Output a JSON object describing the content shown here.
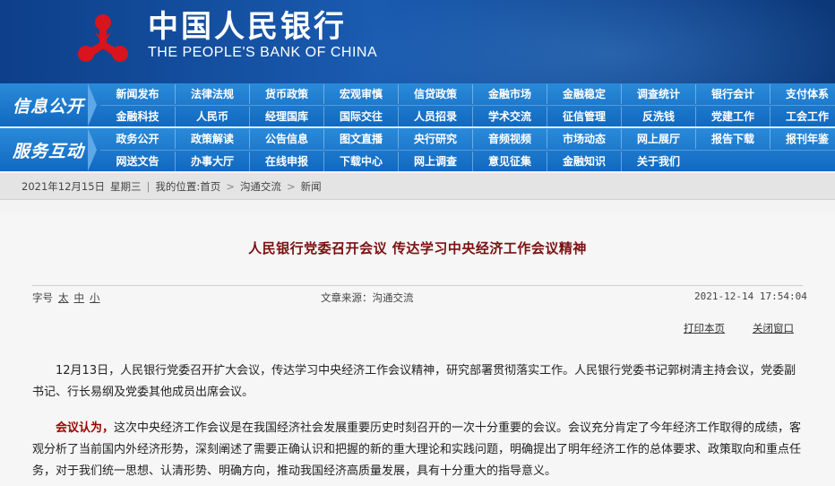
{
  "header": {
    "bank_name_cn": "中国人民银行",
    "bank_name_en": "THE PEOPLE'S BANK OF CHINA",
    "logo_icon": "pboc-emblem-icon",
    "logo_color": "#d8141c"
  },
  "nav": {
    "info_title": "信息公开",
    "service_title": "服务互动",
    "info_rows": [
      [
        "新闻发布",
        "法律法规",
        "货币政策",
        "宏观审慎",
        "信贷政策",
        "金融市场",
        "金融稳定",
        "调查统计",
        "银行会计",
        "支付体系"
      ],
      [
        "金融科技",
        "人民币",
        "经理国库",
        "国际交往",
        "人员招录",
        "学术交流",
        "征信管理",
        "反洗钱",
        "党建工作",
        "工会工作"
      ]
    ],
    "service_rows": [
      [
        "政务公开",
        "政策解读",
        "公告信息",
        "图文直播",
        "央行研究",
        "音频视频",
        "市场动态",
        "网上展厅",
        "报告下载",
        "报刊年鉴"
      ],
      [
        "网送文告",
        "办事大厅",
        "在线申报",
        "下载中心",
        "网上调查",
        "意见征集",
        "金融知识",
        "关于我们"
      ]
    ]
  },
  "breadcrumb": {
    "date": "2021年12月15日",
    "weekday": "星期三",
    "location_label": "我的位置:首页",
    "level1": "沟通交流",
    "level2": "新闻"
  },
  "article": {
    "title": "人民银行党委召开会议  传达学习中央经济工作会议精神",
    "font_size_label": "字号",
    "font_sizes": [
      "太",
      "中",
      "小"
    ],
    "source": "文章来源：沟通交流",
    "datetime": "2021-12-14  17:54:04",
    "print_label": "打印本页",
    "close_label": "关闭窗口",
    "para1": "12月13日，人民银行党委召开扩大会议，传达学习中央经济工作会议精神，研究部署贯彻落实工作。人民银行党委书记郭树清主持会议，党委副书记、行长易纲及党委其他成员出席会议。",
    "para2_lead": "会议认为，",
    "para2_rest": "这次中央经济工作会议是在我国经济社会发展重要历史时刻召开的一次十分重要的会议。会议充分肯定了今年经济工作取得的成绩，客观分析了当前国内外经济形势，深刻阐述了需要正确认识和把握的新的重大理论和实践问题，明确提出了明年经济工作的总体要求、政策取向和重点任务，对于我们统一思想、认清形势、明确方向，推动我国经济高质量发展，具有十分重大的指导意义。"
  }
}
